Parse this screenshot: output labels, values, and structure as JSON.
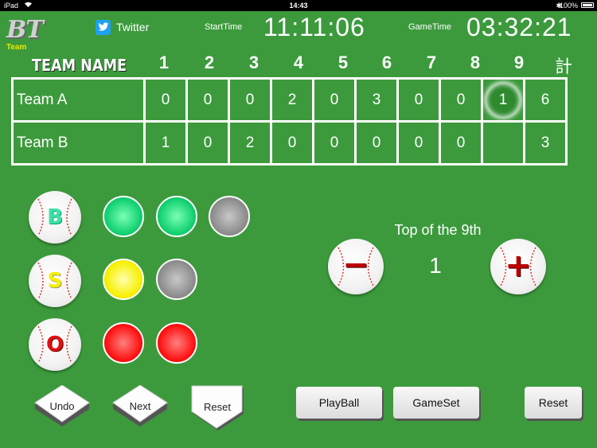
{
  "status_bar": {
    "carrier": "iPad",
    "time": "14:43",
    "battery": "100%"
  },
  "header": {
    "logo": "BT",
    "logo_sub": "Team",
    "twitter_label": "Twitter",
    "start_time_label": "StartTime",
    "start_time": "11:11:06",
    "game_time_label": "GameTime",
    "game_time": "03:32:21"
  },
  "scoreboard": {
    "team_header": "TEAM NAME",
    "innings": [
      "1",
      "2",
      "3",
      "4",
      "5",
      "6",
      "7",
      "8",
      "9"
    ],
    "total_header": "計",
    "rows": [
      {
        "team": "Team A",
        "scores": [
          "0",
          "0",
          "0",
          "2",
          "0",
          "3",
          "0",
          "0",
          "1"
        ],
        "total": "6"
      },
      {
        "team": "Team B",
        "scores": [
          "1",
          "0",
          "2",
          "0",
          "0",
          "0",
          "0",
          "0",
          ""
        ],
        "total": "3"
      }
    ],
    "current_cell": {
      "row": 0,
      "inning": 9
    }
  },
  "count": {
    "ball_label": "B",
    "strike_label": "S",
    "out_label": "O",
    "balls": [
      true,
      true,
      false
    ],
    "strikes": [
      true,
      false
    ],
    "outs": [
      true,
      true
    ]
  },
  "inning_control": {
    "label": "Top of the 9th",
    "value": "1",
    "minus_label": "−",
    "plus_label": "+"
  },
  "buttons": {
    "undo": "Undo",
    "next": "Next",
    "reset_count": "Reset",
    "playball": "PlayBall",
    "gameset": "GameSet",
    "reset_game": "Reset"
  },
  "colors": {
    "background": "#3c9a3c",
    "ball_lamp": "#10d070",
    "strike_lamp": "#f6f000",
    "out_lamp": "#ff1010",
    "off_lamp": "#8c8c8c"
  },
  "icons": {
    "twitter": "twitter-bird-icon",
    "ball": "baseball-icon"
  }
}
